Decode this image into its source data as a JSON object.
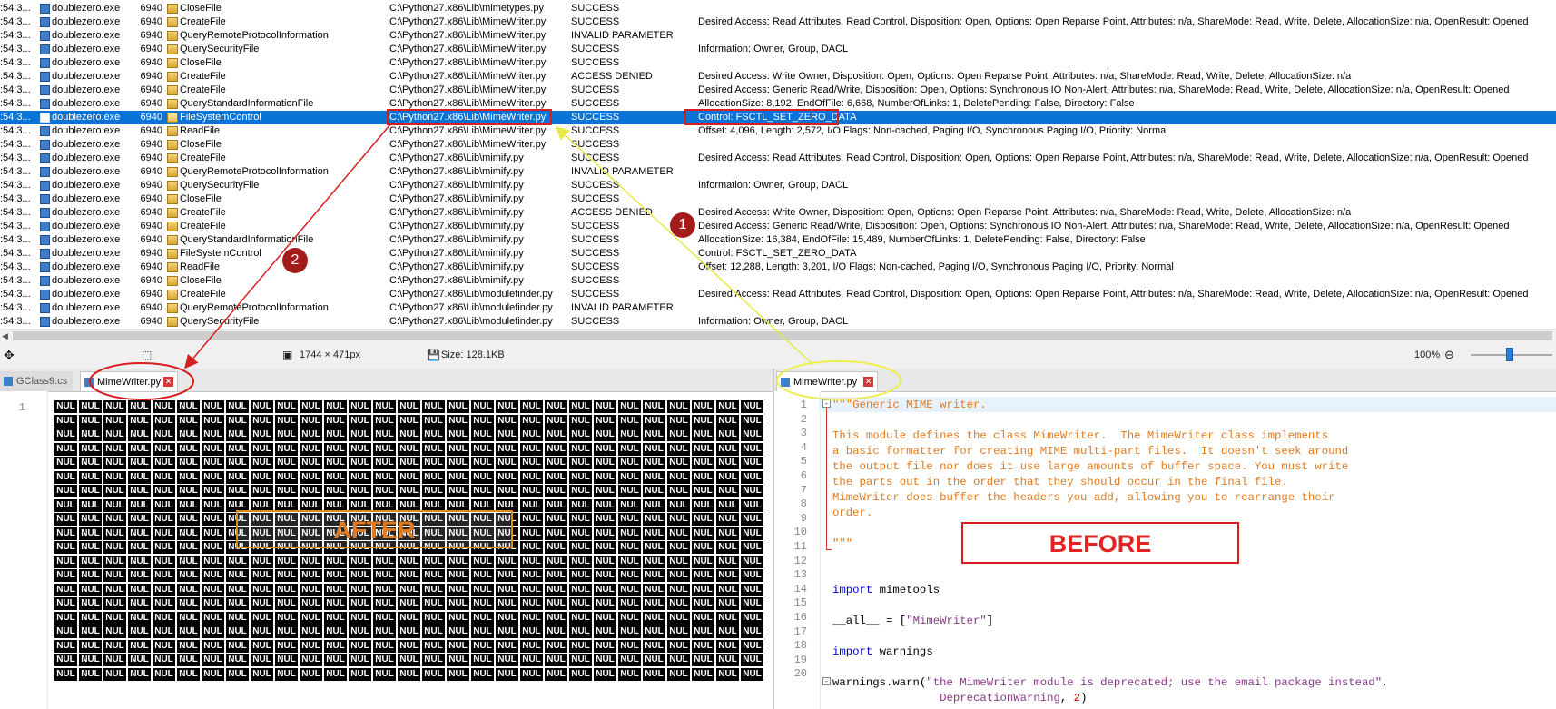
{
  "log": {
    "rows": [
      {
        "time": ":54:3...",
        "process": "doublezero.exe",
        "pid": "6940",
        "operation": "CloseFile",
        "path": "C:\\Python27.x86\\Lib\\mimetypes.py",
        "result": "SUCCESS",
        "detail": ""
      },
      {
        "time": ":54:3...",
        "process": "doublezero.exe",
        "pid": "6940",
        "operation": "CreateFile",
        "path": "C:\\Python27.x86\\Lib\\MimeWriter.py",
        "result": "SUCCESS",
        "detail": "Desired Access: Read Attributes, Read Control, Disposition: Open, Options: Open Reparse Point, Attributes: n/a, ShareMode: Read, Write, Delete, AllocationSize: n/a, OpenResult: Opened"
      },
      {
        "time": ":54:3...",
        "process": "doublezero.exe",
        "pid": "6940",
        "operation": "QueryRemoteProtocolInformation",
        "path": "C:\\Python27.x86\\Lib\\MimeWriter.py",
        "result": "INVALID PARAMETER",
        "detail": ""
      },
      {
        "time": ":54:3...",
        "process": "doublezero.exe",
        "pid": "6940",
        "operation": "QuerySecurityFile",
        "path": "C:\\Python27.x86\\Lib\\MimeWriter.py",
        "result": "SUCCESS",
        "detail": "Information: Owner, Group, DACL"
      },
      {
        "time": ":54:3...",
        "process": "doublezero.exe",
        "pid": "6940",
        "operation": "CloseFile",
        "path": "C:\\Python27.x86\\Lib\\MimeWriter.py",
        "result": "SUCCESS",
        "detail": ""
      },
      {
        "time": ":54:3...",
        "process": "doublezero.exe",
        "pid": "6940",
        "operation": "CreateFile",
        "path": "C:\\Python27.x86\\Lib\\MimeWriter.py",
        "result": "ACCESS DENIED",
        "detail": "Desired Access: Write Owner, Disposition: Open, Options: Open Reparse Point, Attributes: n/a, ShareMode: Read, Write, Delete, AllocationSize: n/a"
      },
      {
        "time": ":54:3...",
        "process": "doublezero.exe",
        "pid": "6940",
        "operation": "CreateFile",
        "path": "C:\\Python27.x86\\Lib\\MimeWriter.py",
        "result": "SUCCESS",
        "detail": "Desired Access: Generic Read/Write, Disposition: Open, Options: Synchronous IO Non-Alert, Attributes: n/a, ShareMode: Read, Write, Delete, AllocationSize: n/a, OpenResult: Opened"
      },
      {
        "time": ":54:3...",
        "process": "doublezero.exe",
        "pid": "6940",
        "operation": "QueryStandardInformationFile",
        "path": "C:\\Python27.x86\\Lib\\MimeWriter.py",
        "result": "SUCCESS",
        "detail": "AllocationSize: 8,192, EndOfFile: 6,668, NumberOfLinks: 1, DeletePending: False, Directory: False"
      },
      {
        "time": ":54:3...",
        "process": "doublezero.exe",
        "pid": "6940",
        "operation": "FileSystemControl",
        "path": "C:\\Python27.x86\\Lib\\MimeWriter.py",
        "result": "SUCCESS",
        "detail": "Control: FSCTL_SET_ZERO_DATA",
        "selected": true
      },
      {
        "time": ":54:3...",
        "process": "doublezero.exe",
        "pid": "6940",
        "operation": "ReadFile",
        "path": "C:\\Python27.x86\\Lib\\MimeWriter.py",
        "result": "SUCCESS",
        "detail": "Offset: 4,096, Length: 2,572, I/O Flags: Non-cached, Paging I/O, Synchronous Paging I/O, Priority: Normal"
      },
      {
        "time": ":54:3...",
        "process": "doublezero.exe",
        "pid": "6940",
        "operation": "CloseFile",
        "path": "C:\\Python27.x86\\Lib\\MimeWriter.py",
        "result": "SUCCESS",
        "detail": ""
      },
      {
        "time": ":54:3...",
        "process": "doublezero.exe",
        "pid": "6940",
        "operation": "CreateFile",
        "path": "C:\\Python27.x86\\Lib\\mimify.py",
        "result": "SUCCESS",
        "detail": "Desired Access: Read Attributes, Read Control, Disposition: Open, Options: Open Reparse Point, Attributes: n/a, ShareMode: Read, Write, Delete, AllocationSize: n/a, OpenResult: Opened"
      },
      {
        "time": ":54:3...",
        "process": "doublezero.exe",
        "pid": "6940",
        "operation": "QueryRemoteProtocolInformation",
        "path": "C:\\Python27.x86\\Lib\\mimify.py",
        "result": "INVALID PARAMETER",
        "detail": ""
      },
      {
        "time": ":54:3...",
        "process": "doublezero.exe",
        "pid": "6940",
        "operation": "QuerySecurityFile",
        "path": "C:\\Python27.x86\\Lib\\mimify.py",
        "result": "SUCCESS",
        "detail": "Information: Owner, Group, DACL"
      },
      {
        "time": ":54:3...",
        "process": "doublezero.exe",
        "pid": "6940",
        "operation": "CloseFile",
        "path": "C:\\Python27.x86\\Lib\\mimify.py",
        "result": "SUCCESS",
        "detail": ""
      },
      {
        "time": ":54:3...",
        "process": "doublezero.exe",
        "pid": "6940",
        "operation": "CreateFile",
        "path": "C:\\Python27.x86\\Lib\\mimify.py",
        "result": "ACCESS DENIED",
        "detail": "Desired Access: Write Owner, Disposition: Open, Options: Open Reparse Point, Attributes: n/a, ShareMode: Read, Write, Delete, AllocationSize: n/a"
      },
      {
        "time": ":54:3...",
        "process": "doublezero.exe",
        "pid": "6940",
        "operation": "CreateFile",
        "path": "C:\\Python27.x86\\Lib\\mimify.py",
        "result": "SUCCESS",
        "detail": "Desired Access: Generic Read/Write, Disposition: Open, Options: Synchronous IO Non-Alert, Attributes: n/a, ShareMode: Read, Write, Delete, AllocationSize: n/a, OpenResult: Opened"
      },
      {
        "time": ":54:3...",
        "process": "doublezero.exe",
        "pid": "6940",
        "operation": "QueryStandardInformationFile",
        "path": "C:\\Python27.x86\\Lib\\mimify.py",
        "result": "SUCCESS",
        "detail": "AllocationSize: 16,384, EndOfFile: 15,489, NumberOfLinks: 1, DeletePending: False, Directory: False"
      },
      {
        "time": ":54:3...",
        "process": "doublezero.exe",
        "pid": "6940",
        "operation": "FileSystemControl",
        "path": "C:\\Python27.x86\\Lib\\mimify.py",
        "result": "SUCCESS",
        "detail": "Control: FSCTL_SET_ZERO_DATA"
      },
      {
        "time": ":54:3...",
        "process": "doublezero.exe",
        "pid": "6940",
        "operation": "ReadFile",
        "path": "C:\\Python27.x86\\Lib\\mimify.py",
        "result": "SUCCESS",
        "detail": "Offset: 12,288, Length: 3,201, I/O Flags: Non-cached, Paging I/O, Synchronous Paging I/O, Priority: Normal"
      },
      {
        "time": ":54:3...",
        "process": "doublezero.exe",
        "pid": "6940",
        "operation": "CloseFile",
        "path": "C:\\Python27.x86\\Lib\\mimify.py",
        "result": "SUCCESS",
        "detail": ""
      },
      {
        "time": ":54:3...",
        "process": "doublezero.exe",
        "pid": "6940",
        "operation": "CreateFile",
        "path": "C:\\Python27.x86\\Lib\\modulefinder.py",
        "result": "SUCCESS",
        "detail": "Desired Access: Read Attributes, Read Control, Disposition: Open, Options: Open Reparse Point, Attributes: n/a, ShareMode: Read, Write, Delete, AllocationSize: n/a, OpenResult: Opened"
      },
      {
        "time": ":54:3...",
        "process": "doublezero.exe",
        "pid": "6940",
        "operation": "QueryRemoteProtocolInformation",
        "path": "C:\\Python27.x86\\Lib\\modulefinder.py",
        "result": "INVALID PARAMETER",
        "detail": ""
      },
      {
        "time": ":54:3...",
        "process": "doublezero.exe",
        "pid": "6940",
        "operation": "QuerySecurityFile",
        "path": "C:\\Python27.x86\\Lib\\modulefinder.py",
        "result": "SUCCESS",
        "detail": "Information: Owner, Group, DACL"
      }
    ]
  },
  "status_bar": {
    "dimensions": "1744 × 471px",
    "size": "Size: 128.1KB",
    "zoom": "100%",
    "icons": [
      "move-icon",
      "selection-icon",
      "dimensions-icon",
      "save-icon",
      "zoom-out-icon"
    ]
  },
  "left_editor": {
    "tabs": [
      {
        "label": "GClass9.cs",
        "active": false
      },
      {
        "label": "MimeWriter.py",
        "active": true
      }
    ],
    "line_numbers": [
      "1"
    ],
    "nul_token": "NUL",
    "annotation_label": "AFTER"
  },
  "right_editor": {
    "tabs": [
      {
        "label": "MimeWriter.py",
        "active": true
      }
    ],
    "line_numbers": [
      "1",
      "2",
      "3",
      "4",
      "5",
      "6",
      "7",
      "8",
      "9",
      "10",
      "11",
      "12",
      "13",
      "14",
      "15",
      "16",
      "17",
      "18",
      "19",
      "20"
    ],
    "annotation_label": "BEFORE"
  },
  "annotations": {
    "badge_1": "1",
    "badge_2": "2",
    "colors": {
      "red": "#d81e1e",
      "yellow": "#f2f25a",
      "badge": "#a31b1b",
      "selection": "#0a73d6",
      "doc": "#e07b1f"
    }
  }
}
